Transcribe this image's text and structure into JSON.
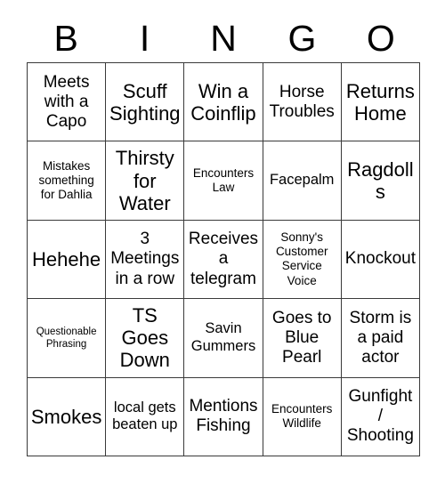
{
  "card": {
    "header_letters": [
      "B",
      "I",
      "N",
      "G",
      "O"
    ],
    "columns": 5,
    "rows": 5,
    "colors": {
      "background": "#ffffff",
      "text": "#000000",
      "border": "#3a3a3a"
    },
    "cells": [
      {
        "text": "Meets with a Capo",
        "size": "lg"
      },
      {
        "text": "Scuff Sighting",
        "size": "xl"
      },
      {
        "text": "Win a Coinflip",
        "size": "xl"
      },
      {
        "text": "Horse Troubles",
        "size": "lg"
      },
      {
        "text": "Returns Home",
        "size": "xl"
      },
      {
        "text": "Mistakes something for Dahlia",
        "size": "sm"
      },
      {
        "text": "Thirsty for Water",
        "size": "xl"
      },
      {
        "text": "Encounters Law",
        "size": "sm"
      },
      {
        "text": "Facepalm",
        "size": "md"
      },
      {
        "text": "Ragdolls",
        "size": "xl"
      },
      {
        "text": "Hehehe",
        "size": "xl"
      },
      {
        "text": "3 Meetings in a row",
        "size": "lg"
      },
      {
        "text": "Receives a telegram",
        "size": "lg"
      },
      {
        "text": "Sonny's Customer Service Voice",
        "size": "sm"
      },
      {
        "text": "Knockout",
        "size": "lg"
      },
      {
        "text": "Questionable Phrasing",
        "size": "xs"
      },
      {
        "text": "TS Goes Down",
        "size": "xl"
      },
      {
        "text": "Savin Gummers",
        "size": "md"
      },
      {
        "text": "Goes to Blue Pearl",
        "size": "lg"
      },
      {
        "text": "Storm is a paid actor",
        "size": "lg"
      },
      {
        "text": "Smokes",
        "size": "xl"
      },
      {
        "text": "local gets beaten up",
        "size": "md"
      },
      {
        "text": "Mentions Fishing",
        "size": "lg"
      },
      {
        "text": "Encounters Wildlife",
        "size": "sm"
      },
      {
        "text": "Gunfight / Shooting",
        "size": "lg"
      }
    ]
  }
}
